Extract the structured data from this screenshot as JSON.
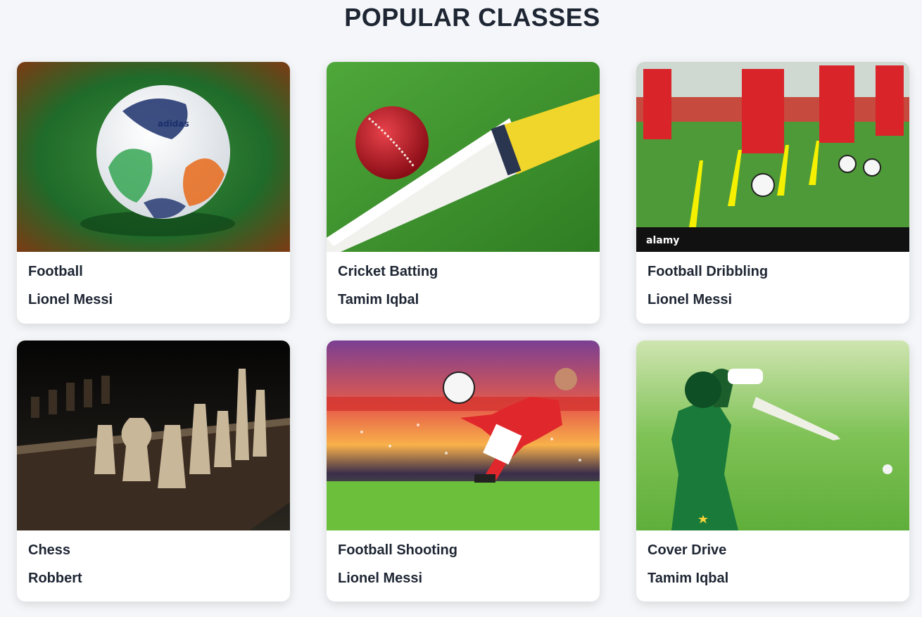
{
  "page": {
    "title": "POPULAR CLASSES"
  },
  "classes": [
    {
      "name": "Football",
      "instructor": "Lionel Messi",
      "image": "football-ball-on-grass"
    },
    {
      "name": "Cricket Batting",
      "instructor": "Tamim Iqbal",
      "image": "cricket-ball-on-bat"
    },
    {
      "name": "Football Dribbling",
      "instructor": "Lionel Messi",
      "image": "kids-dribbling-cones",
      "image_caption": "alamy"
    },
    {
      "name": "Chess",
      "instructor": "Robbert",
      "image": "chess-pieces-on-board"
    },
    {
      "name": "Football Shooting",
      "instructor": "Lionel Messi",
      "image": "player-kicking-ball-stadium"
    },
    {
      "name": "Cover Drive",
      "instructor": "Tamim Iqbal",
      "image": "batsman-cover-drive"
    }
  ],
  "colors": {
    "background": "#f4f6f9",
    "card": "#ffffff",
    "text": "#1e2633"
  }
}
